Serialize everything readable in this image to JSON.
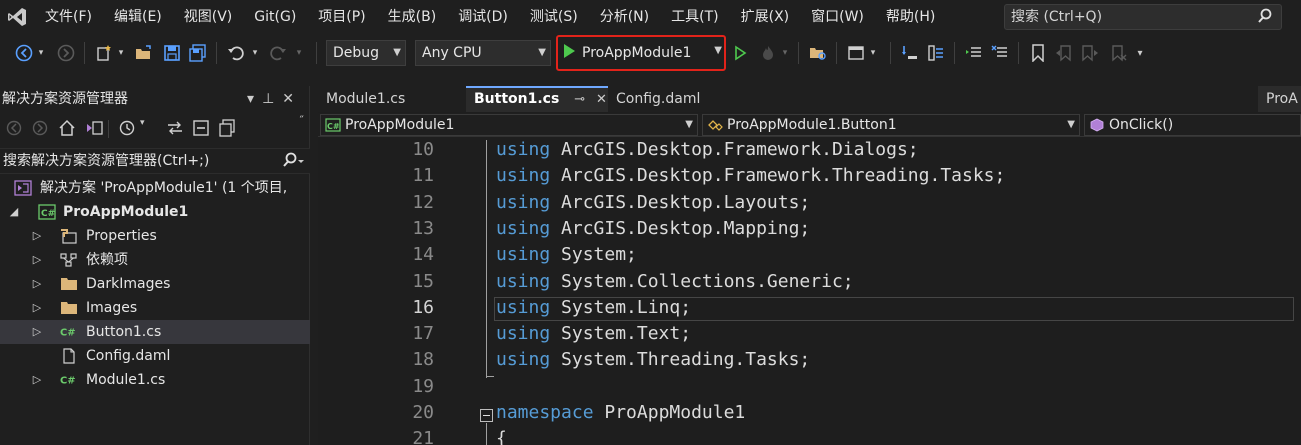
{
  "menu": {
    "items": [
      "文件(F)",
      "编辑(E)",
      "视图(V)",
      "Git(G)",
      "项目(P)",
      "生成(B)",
      "调试(D)",
      "测试(S)",
      "分析(N)",
      "工具(T)",
      "扩展(X)",
      "窗口(W)",
      "帮助(H)"
    ],
    "search_placeholder": "搜索 (Ctrl+Q)"
  },
  "toolbar": {
    "configuration": "Debug",
    "platform": "Any CPU",
    "start_target": "ProAppModule1"
  },
  "solution_explorer": {
    "title": "解决方案资源管理器",
    "search_placeholder": "搜索解决方案资源管理器(Ctrl+;)",
    "solution_label": "解决方案 'ProAppModule1' (1 个项目,",
    "project_label": "ProAppModule1",
    "items": [
      {
        "label": "Properties",
        "icon": "wrench-icon",
        "expandable": true
      },
      {
        "label": "依赖项",
        "icon": "dependencies-icon",
        "expandable": true
      },
      {
        "label": "DarkImages",
        "icon": "folder-icon",
        "expandable": true
      },
      {
        "label": "Images",
        "icon": "folder-icon",
        "expandable": true
      },
      {
        "label": "Button1.cs",
        "icon": "csharp-file-icon",
        "expandable": true,
        "selected": true
      },
      {
        "label": "Config.daml",
        "icon": "file-icon",
        "expandable": false
      },
      {
        "label": "Module1.cs",
        "icon": "csharp-file-icon",
        "expandable": true
      }
    ]
  },
  "editor": {
    "tabs": [
      {
        "label": "Module1.cs",
        "active": false
      },
      {
        "label": "Button1.cs",
        "active": true
      },
      {
        "label": "Config.daml",
        "active": false
      }
    ],
    "overflow_tab": "ProA",
    "nav": {
      "project": "ProAppModule1",
      "type": "ProAppModule1.Button1",
      "member": "OnClick()"
    },
    "current_line": 16,
    "lines": [
      {
        "n": "10",
        "kw": "using",
        "rest": " ArcGIS.Desktop.Framework.Dialogs;"
      },
      {
        "n": "11",
        "kw": "using",
        "rest": " ArcGIS.Desktop.Framework.Threading.Tasks;"
      },
      {
        "n": "12",
        "kw": "using",
        "rest": " ArcGIS.Desktop.Layouts;"
      },
      {
        "n": "13",
        "kw": "using",
        "rest": " ArcGIS.Desktop.Mapping;"
      },
      {
        "n": "14",
        "kw": "using",
        "rest": " System;"
      },
      {
        "n": "15",
        "kw": "using",
        "rest": " System.Collections.Generic;"
      },
      {
        "n": "16",
        "kw": "using",
        "rest": " System.Linq;"
      },
      {
        "n": "17",
        "kw": "using",
        "rest": " System.Text;"
      },
      {
        "n": "18",
        "kw": "using",
        "rest": " System.Threading.Tasks;"
      },
      {
        "n": "19",
        "kw": "",
        "rest": ""
      },
      {
        "n": "20",
        "kw": "namespace",
        "rest": " ProAppModule1"
      },
      {
        "n": "21",
        "kw": "",
        "rest": "{"
      }
    ]
  },
  "colors": {
    "keyword": "#569cd6",
    "start_highlight": "#e2231a",
    "play_green": "#4ec94e"
  }
}
